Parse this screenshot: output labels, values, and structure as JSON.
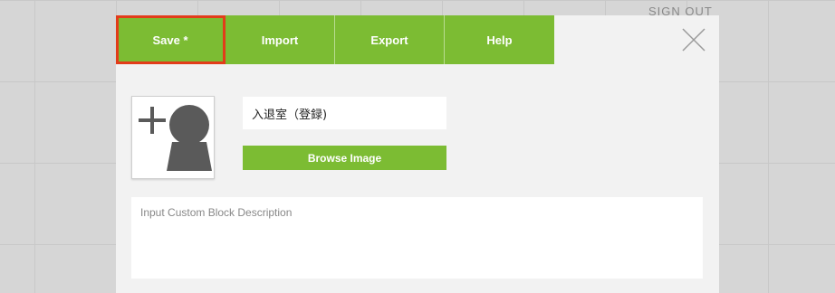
{
  "background": {
    "signout_label": "SIGN OUT"
  },
  "toolbar": {
    "tabs": [
      {
        "label": "Save *",
        "active": true
      },
      {
        "label": "Import"
      },
      {
        "label": "Export"
      },
      {
        "label": "Help"
      }
    ],
    "accent_color": "#7cbc33",
    "highlight_color": "#e23c1a"
  },
  "dialog": {
    "close_icon": "close-icon",
    "avatar_icon": "add-person-icon",
    "block_name": "入退室（登録)",
    "browse_label": "Browse Image",
    "description_placeholder": "Input Custom Block Description",
    "description_value": ""
  }
}
